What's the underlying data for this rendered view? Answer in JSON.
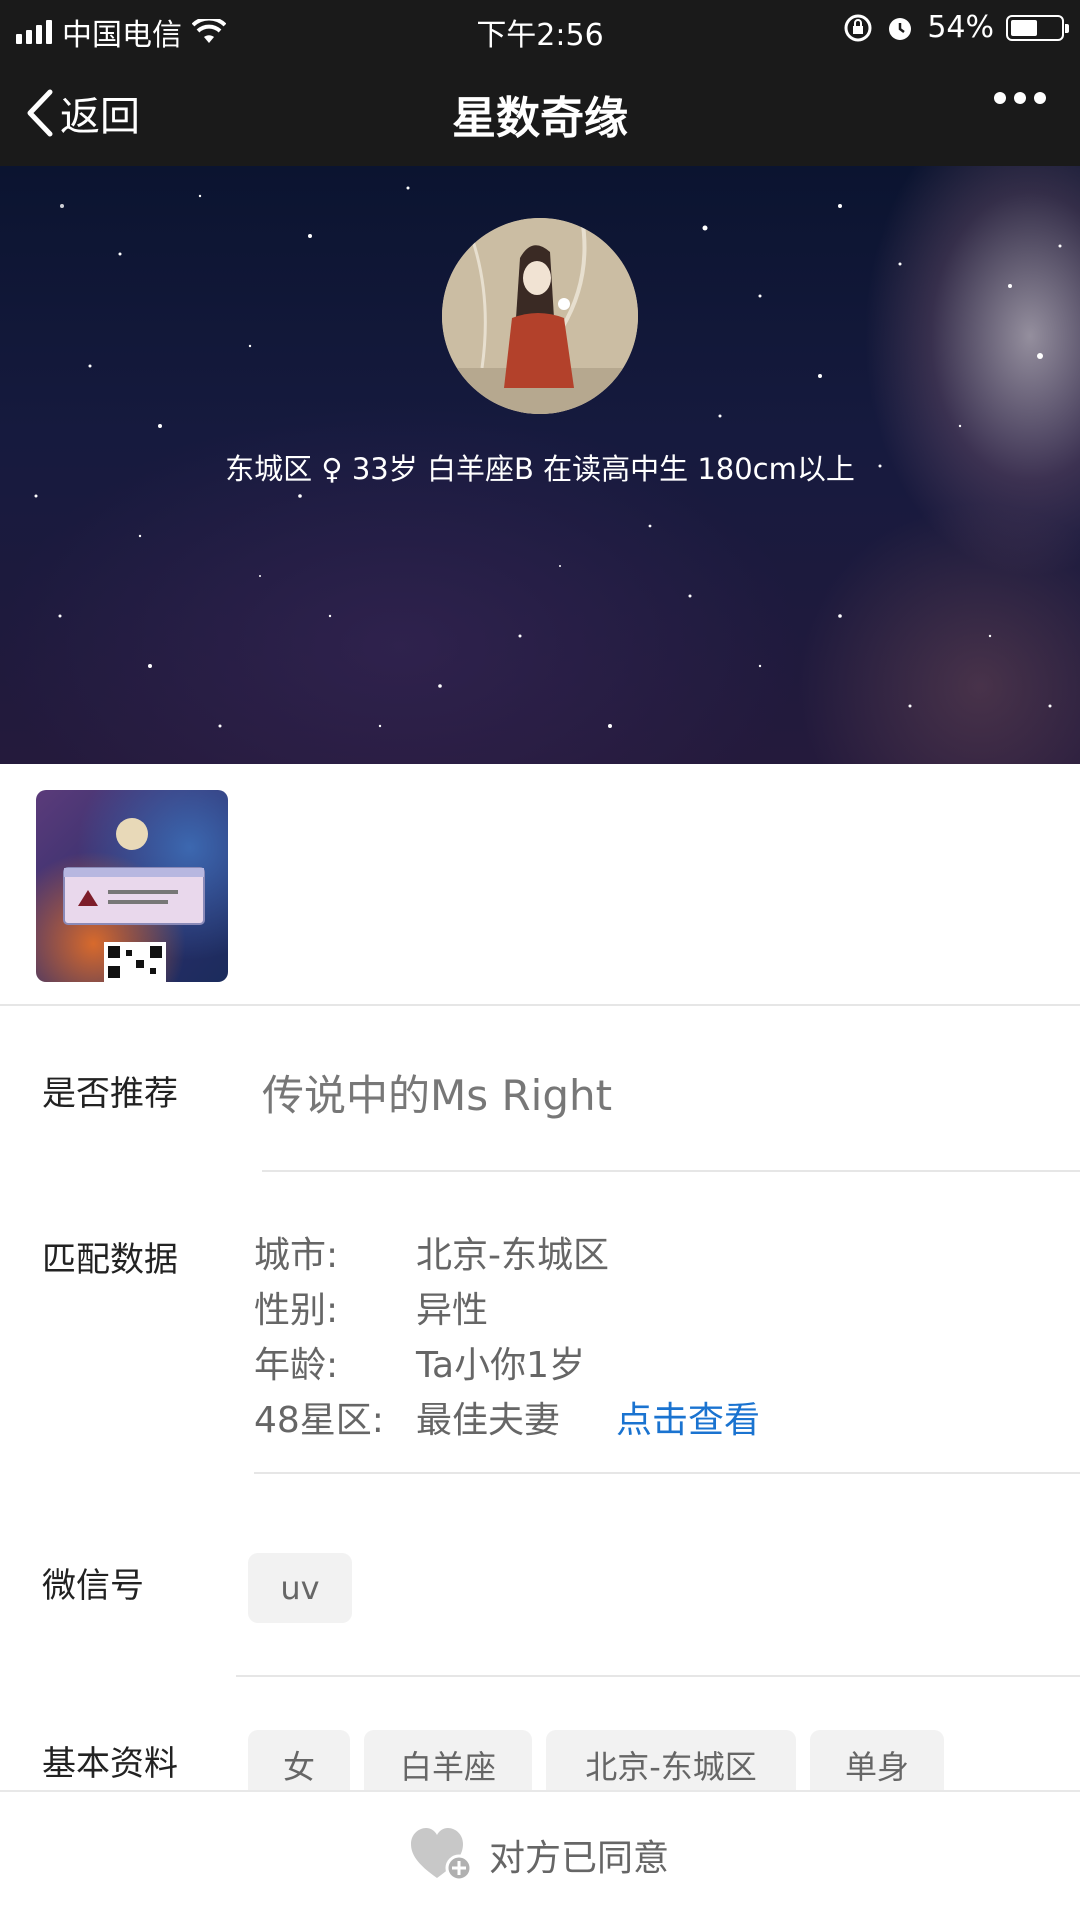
{
  "status_bar": {
    "carrier": "中国电信",
    "time": "下午2:56",
    "battery": "54%",
    "battery_level": 0.54
  },
  "nav": {
    "back_label": "返回",
    "title": "星数奇缘",
    "more_icon": "more-dots-icon"
  },
  "profile": {
    "district": "东城区",
    "gender_symbol": "♀",
    "age": "33岁",
    "zodiac": "白羊座B",
    "education": "在读高中生",
    "height": "180cm以上"
  },
  "thumbnail": {
    "icon": "qr-card-image"
  },
  "recommend": {
    "label": "是否推荐",
    "value": "传说中的Ms Right"
  },
  "match": {
    "label": "匹配数据",
    "rows": [
      {
        "key": "城市:",
        "value": "北京-东城区"
      },
      {
        "key": "性别:",
        "value": "异性"
      },
      {
        "key": "年龄:",
        "value": "Ta小你1岁"
      },
      {
        "key": "48星区:",
        "value": "最佳夫妻",
        "link": "点击查看"
      }
    ]
  },
  "wechat": {
    "label": "微信号",
    "value": "uv"
  },
  "basic": {
    "label": "基本资料",
    "tags": [
      "女",
      "白羊座",
      "北京-东城区",
      "单身"
    ]
  },
  "bottom": {
    "status": "对方已同意",
    "icon": "heart-plus-icon"
  },
  "colors": {
    "bar_bg": "#1a1a1a",
    "link": "#1a73d0"
  }
}
